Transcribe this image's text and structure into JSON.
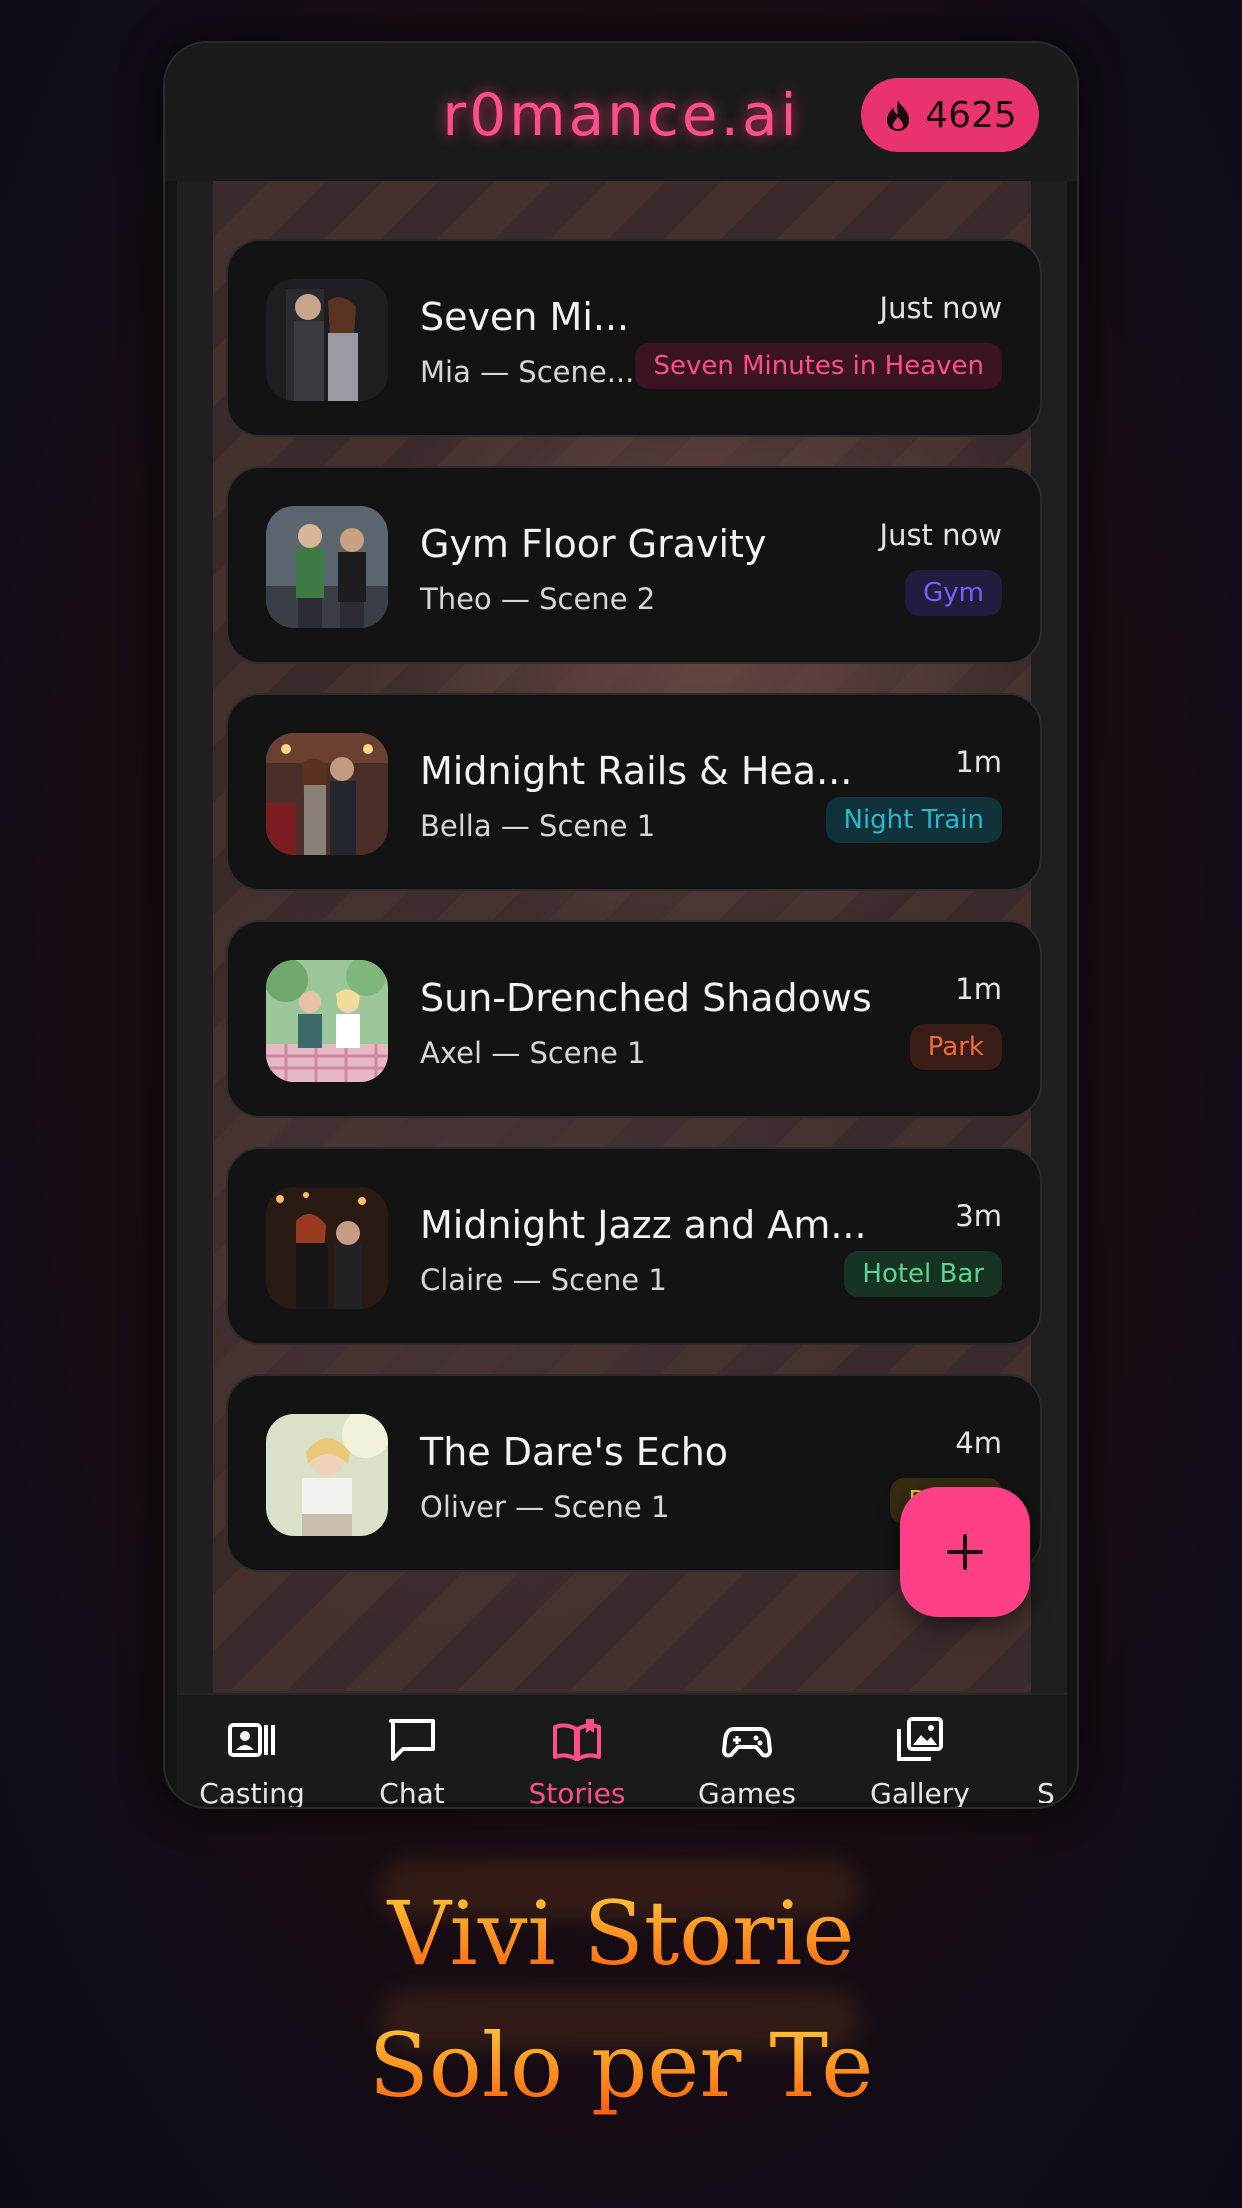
{
  "header": {
    "brand": "r0mance.ai",
    "credits": "4625"
  },
  "stories": [
    {
      "title": "Seven Mi...",
      "subtitle": "Mia — Scene...",
      "time": "Just now",
      "tag": "Seven Minutes in Heaven",
      "tag_color": "#ff4f8b",
      "tag_bg": "#3b1423"
    },
    {
      "title": "Gym Floor Gravity",
      "subtitle": "Theo — Scene 2",
      "time": "Just now",
      "tag": "Gym",
      "tag_color": "#7b5cff",
      "tag_bg": "#221c3e"
    },
    {
      "title": "Midnight Rails & Hea...",
      "subtitle": "Bella — Scene 1",
      "time": "1m",
      "tag": "Night Train",
      "tag_color": "#2ab7cf",
      "tag_bg": "#10323a"
    },
    {
      "title": "Sun-Drenched Shadows",
      "subtitle": "Axel — Scene 1",
      "time": "1m",
      "tag": "Park",
      "tag_color": "#f06a3f",
      "tag_bg": "#3a1d16"
    },
    {
      "title": "Midnight Jazz and Am...",
      "subtitle": "Claire — Scene 1",
      "time": "3m",
      "tag": "Hotel Bar",
      "tag_color": "#5fd48e",
      "tag_bg": "#163324"
    },
    {
      "title": "The Dare's Echo",
      "subtitle": "Oliver — Scene 1",
      "time": "4m",
      "tag": "Dares",
      "tag_color": "#f4c531",
      "tag_bg": "#352c12"
    }
  ],
  "nav": {
    "casting": "Casting",
    "chat": "Chat",
    "stories": "Stories",
    "games": "Games",
    "gallery": "Gallery",
    "more": "S"
  },
  "tagline": {
    "line1": "Vivi Storie",
    "line2": "Solo per Te"
  },
  "colors": {
    "accent": "#ff4f8b",
    "fab": "#ff3f86",
    "credits_bg": "#e8336f"
  }
}
